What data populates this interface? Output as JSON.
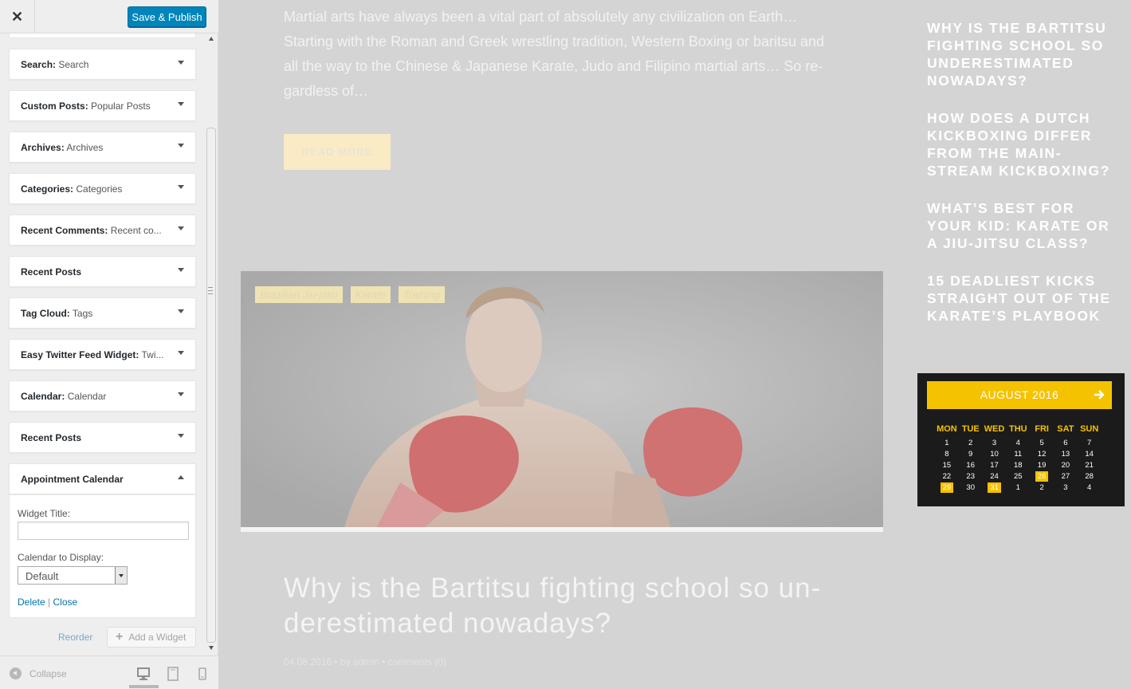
{
  "customizer": {
    "close_glyph": "✕",
    "save_label": "Save & Publish",
    "widgets": [
      {
        "type": "Search",
        "title": "Search"
      },
      {
        "type": "Custom Posts",
        "title": "Popular Posts"
      },
      {
        "type": "Archives",
        "title": "Archives"
      },
      {
        "type": "Categories",
        "title": "Categories"
      },
      {
        "type": "Recent Comments",
        "title": "Recent co..."
      },
      {
        "type": "Recent Posts",
        "title": ""
      },
      {
        "type": "Tag Cloud",
        "title": "Tags"
      },
      {
        "type": "Easy Twitter Feed Widget",
        "title": "Twi..."
      },
      {
        "type": "Calendar",
        "title": "Calendar"
      },
      {
        "type": "Recent Posts",
        "title": ""
      },
      {
        "type": "Appointment Calendar",
        "title": ""
      }
    ],
    "appointment_form": {
      "widget_title_label": "Widget Title:",
      "widget_title_value": "",
      "calendar_label": "Calendar to Display:",
      "calendar_value": "Default",
      "delete_label": "Delete",
      "separator": "|",
      "close_label": "Close"
    },
    "reorder_label": "Reorder",
    "add_widget_label": "Add a Widget",
    "collapse_label": "Collapse",
    "devices": [
      "desktop-icon",
      "tablet-icon",
      "mobile-icon"
    ],
    "active_device": "desktop"
  },
  "preview": {
    "excerpt": "Martial arts have always been a vital part of absolutely any civilization on Earth… Starting with the Roman and Greek wrestling tradition, Western Boxing or baritsu and all the way to the Chinese & Japanese Karate, Judo and Filipino martial arts… So re-gardless of…",
    "read_more": "READ MORE",
    "tags": [
      "Brazilian Jiu-jitsu",
      "Karate",
      "Training"
    ],
    "post_title": "Why is the Bartitsu fighting school so un-derestimated nowadays?",
    "post_meta": "04.08.2016  •  by admin  •  comments (0)",
    "recent_posts": [
      "Why is the Bartitsu fighting school so underestimated nowadays?",
      "How does a Dutch kickboxing differ from the main-stream kickboxing?",
      "What’s best for your kid: Karate or a Jiu-Jitsu class?",
      "15 deadliest kicks straight out of the Karate’s playbook"
    ],
    "calendar": {
      "month": "AUGUST 2016",
      "days": [
        "MON",
        "TUE",
        "WED",
        "THU",
        "FRI",
        "SAT",
        "SUN"
      ],
      "weeks": [
        [
          "1",
          "2",
          "3",
          "4",
          "5",
          "6",
          "7"
        ],
        [
          "8",
          "9",
          "10",
          "11",
          "12",
          "13",
          "14"
        ],
        [
          "15",
          "16",
          "17",
          "18",
          "19",
          "20",
          "21"
        ],
        [
          "22",
          "23",
          "24",
          "25",
          "26",
          "27",
          "28"
        ],
        [
          "29",
          "30",
          "31",
          "1",
          "2",
          "3",
          "4"
        ]
      ],
      "highlighted": [
        "26",
        "29",
        "31"
      ],
      "accent": "#f5c200"
    }
  }
}
